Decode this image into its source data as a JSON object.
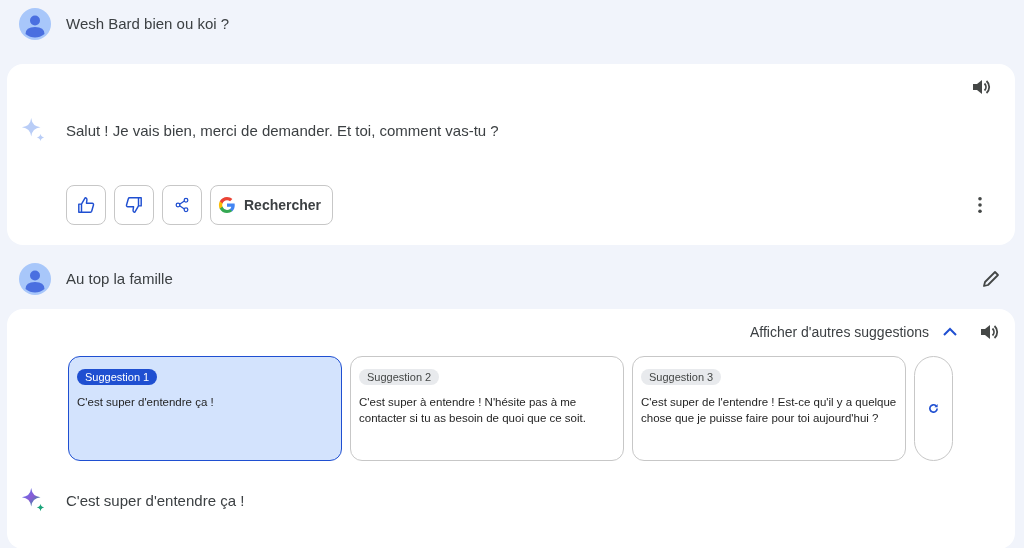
{
  "first_prompt": {
    "text": "Wesh Bard bien ou koi ?"
  },
  "first_response": {
    "text": "Salut ! Je vais bien, merci de demander. Et toi, comment vas-tu ?",
    "search_button": "Rechercher"
  },
  "second_prompt": {
    "text": "Au top la famille"
  },
  "second_response": {
    "more_suggestions": {
      "label": "Afficher d'autres suggestions",
      "expanded": true
    },
    "suggestions": [
      {
        "label": "Suggestion 1",
        "text": "C'est super d'entendre ça !",
        "selected": true
      },
      {
        "label": "Suggestion 2",
        "text": "C'est super à entendre ! N'hésite pas à me contacter si tu as besoin de quoi que ce soit.",
        "selected": false
      },
      {
        "label": "Suggestion 3",
        "text": "C'est super de l'entendre ! Est-ce qu'il y a quelque chose que je puisse faire pour toi aujourd'hui ?",
        "selected": false
      }
    ],
    "text": "C'est super d'entendre ça !"
  }
}
